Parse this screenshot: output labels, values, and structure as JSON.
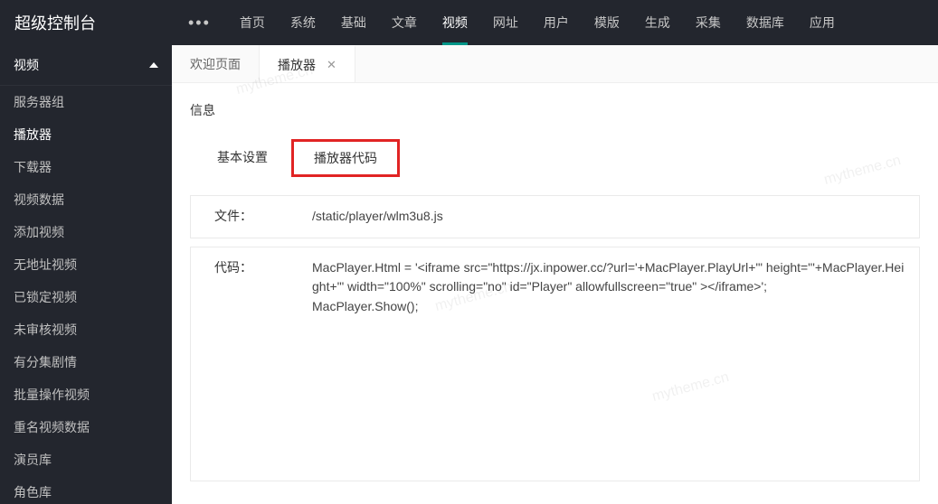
{
  "logo": "超级控制台",
  "topMenu": {
    "ellipsis": "•••",
    "items": [
      "首页",
      "系统",
      "基础",
      "文章",
      "视频",
      "网址",
      "用户",
      "模版",
      "生成",
      "采集",
      "数据库",
      "应用"
    ],
    "activeIndex": 4
  },
  "sidebar": {
    "group": "视频",
    "items": [
      "服务器组",
      "播放器",
      "下载器",
      "视频数据",
      "添加视频",
      "无地址视频",
      "已锁定视频",
      "未审核视频",
      "有分集剧情",
      "批量操作视频",
      "重名视频数据",
      "演员库",
      "角色库"
    ],
    "activeIndex": 1
  },
  "tabs": {
    "items": [
      {
        "label": "欢迎页面",
        "closable": false
      },
      {
        "label": "播放器",
        "closable": true
      }
    ],
    "activeIndex": 1
  },
  "panel": {
    "title": "信息",
    "innerTabs": {
      "basic": "基本设置",
      "code": "播放器代码"
    },
    "fileLabel": "文件：",
    "fileValue": "/static/player/wlm3u8.js",
    "codeLabel": "代码：",
    "codeValue": "MacPlayer.Html = '<iframe src=\"https://jx.inpower.cc/?url='+MacPlayer.PlayUrl+'\" height=\"'+MacPlayer.Height+'\" width=\"100%\" scrolling=\"no\" id=\"Player\" allowfullscreen=\"true\" ></iframe>';\nMacPlayer.Show();"
  },
  "watermark": "mytheme.cn"
}
